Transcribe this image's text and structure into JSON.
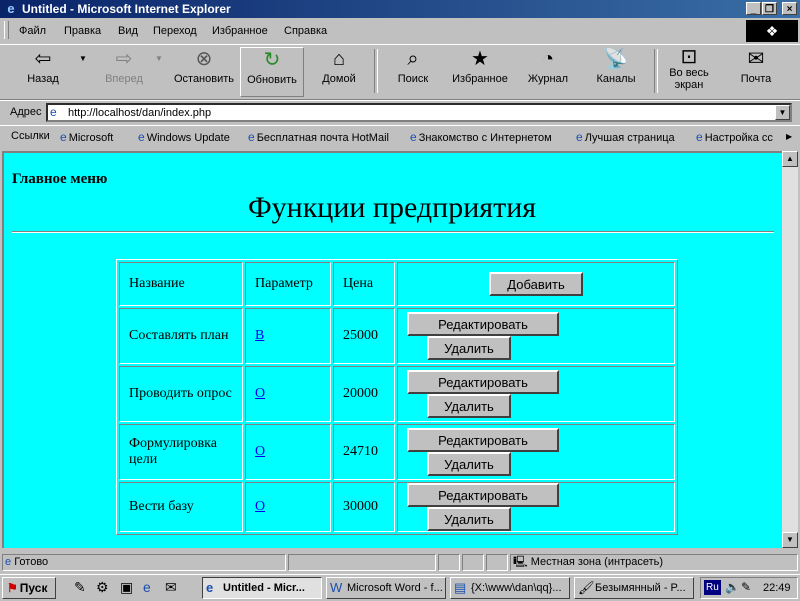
{
  "window": {
    "title": "Untitled - Microsoft Internet Explorer"
  },
  "menu": [
    "Файл",
    "Правка",
    "Вид",
    "Переход",
    "Избранное",
    "Справка"
  ],
  "toolbar": {
    "back": "Назад",
    "forward": "Вперед",
    "stop": "Остановить",
    "refresh": "Обновить",
    "home": "Домой",
    "search": "Поиск",
    "favorites": "Избранное",
    "history": "Журнал",
    "channels": "Каналы",
    "fullscreen_1": "Во весь",
    "fullscreen_2": "экран",
    "mail": "Почта"
  },
  "address": {
    "label": "Адрес",
    "value": "http://localhost/dan/index.php"
  },
  "links": {
    "label": "Ссылки",
    "items": [
      "Microsoft",
      "Windows Update",
      "Бесплатная почта HotMail",
      "Знакомство с Интернетом",
      "Лучшая страница",
      "Настройка сс"
    ]
  },
  "page": {
    "main_menu": "Главное меню",
    "title": "Функции предприятия",
    "headers": {
      "name": "Название",
      "param": "Параметр",
      "price": "Цена"
    },
    "add_button": "Добавить",
    "edit_button": "Редактировать",
    "delete_button": "Удалить",
    "rows": [
      {
        "name": "Составлять план",
        "param": "В",
        "price": "25000"
      },
      {
        "name": "Проводить опрос",
        "param": "О",
        "price": "20000"
      },
      {
        "name": "Формулировка цели",
        "param": "О",
        "price": "24710"
      },
      {
        "name": "Вести базу",
        "param": "О",
        "price": "30000"
      }
    ]
  },
  "status": {
    "text": "Готово",
    "zone": "Местная зона (интрасеть)"
  },
  "taskbar": {
    "start": "Пуск",
    "tasks": [
      "Untitled - Micr...",
      "Microsoft Word - f...",
      "{X:\\www\\dan\\qq}...",
      "Безымянный - P..."
    ],
    "lang": "Ru",
    "clock": "22:49"
  }
}
